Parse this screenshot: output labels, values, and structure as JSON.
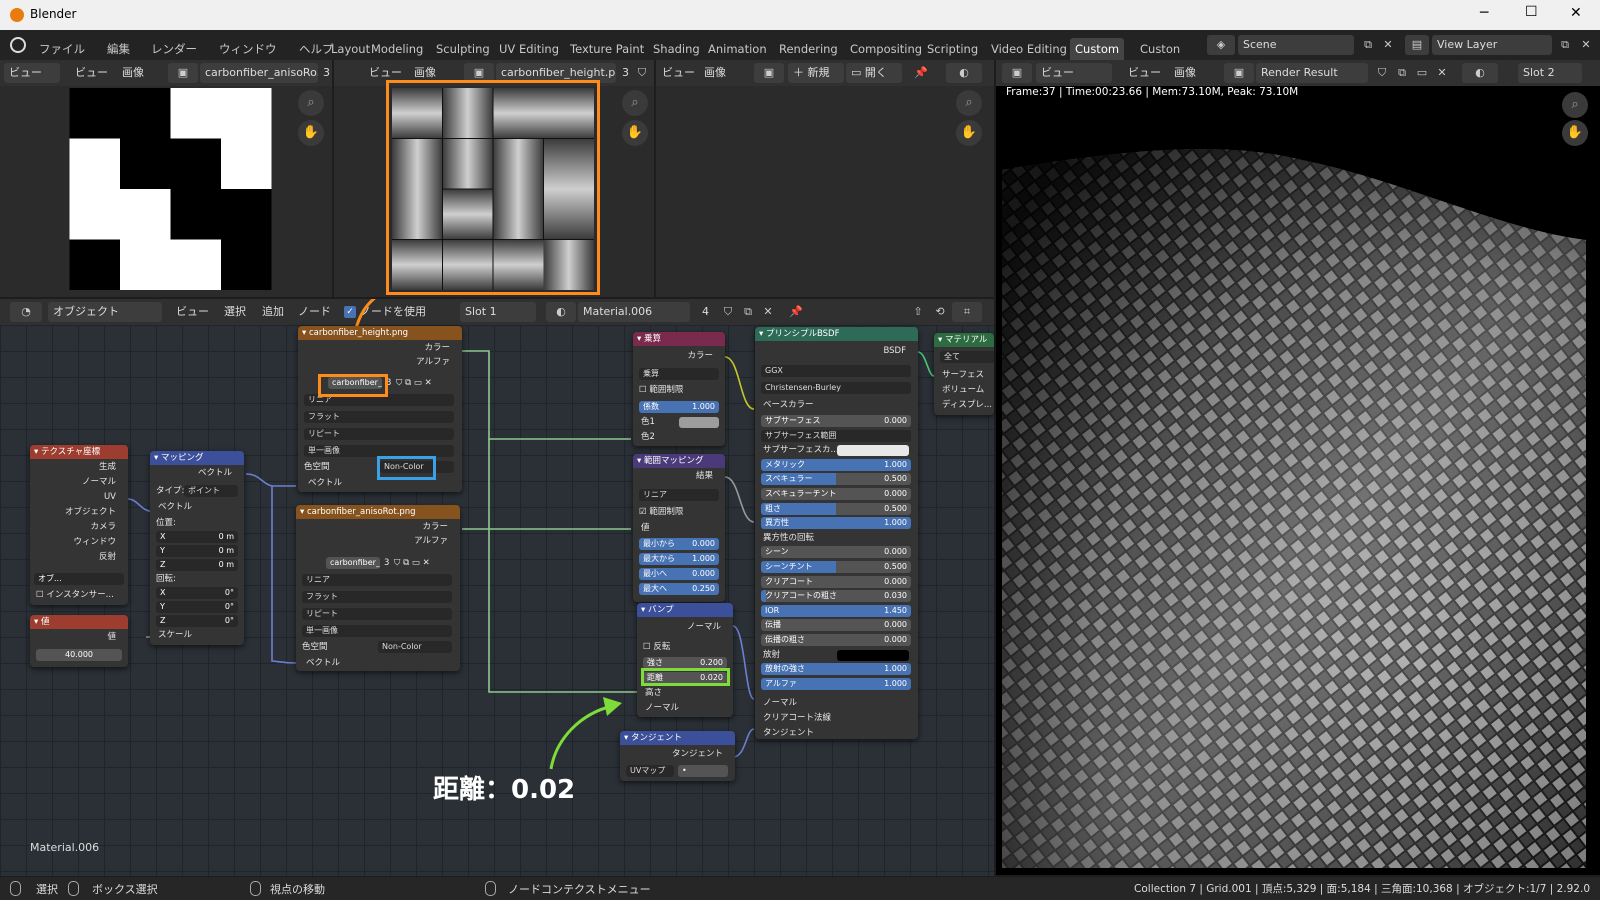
{
  "window": {
    "title": "Blender",
    "minimize": "─",
    "maximize": "☐",
    "close": "✕"
  },
  "menu": [
    "ファイル",
    "編集",
    "レンダー",
    "ウィンドウ",
    "ヘルプ"
  ],
  "workspaces": [
    "Layout",
    "Modeling",
    "Sculpting",
    "UV Editing",
    "Texture Paint",
    "Shading",
    "Animation",
    "Rendering",
    "Compositing",
    "Scripting",
    "Video Editing",
    "Custom",
    "Custon"
  ],
  "active_workspace": "Custom",
  "scene": "Scene",
  "view_layer": "View Layer",
  "image_editor_1": {
    "mode": "ビュー",
    "view": "ビュー",
    "image": "画像",
    "image_name": "carbonfiber_anisoRo...",
    "users": "3"
  },
  "image_editor_2": {
    "view": "ビュー",
    "image": "画像",
    "image_name": "carbonfiber_height.p...",
    "users": "3"
  },
  "image_editor_3": {
    "view": "ビュー",
    "image": "画像",
    "new": "新規",
    "open": "開く"
  },
  "render_editor": {
    "view": "ビュー",
    "view2": "ビュー",
    "image": "画像",
    "result": "Render Result",
    "slot": "Slot 2",
    "info": "Frame:37 | Time:00:23.66 | Mem:73.10M, Peak: 73.10M"
  },
  "node_editor": {
    "mode": "オブジェクト",
    "view": "ビュー",
    "select": "選択",
    "add": "追加",
    "node": "ノード",
    "use_nodes": "ノードを使用",
    "slot": "Slot 1",
    "material": "Material.006",
    "users": "4",
    "footer_material": "Material.006"
  },
  "nodes": {
    "texcoord": {
      "title": "テクスチャ座標",
      "outputs": [
        "生成",
        "ノーマル",
        "UV",
        "オブジェクト",
        "カメラ",
        "ウィンドウ",
        "反射"
      ],
      "object_label": "オブ...",
      "instancer": "インスタンサー..."
    },
    "value": {
      "title": "値",
      "output": "値",
      "value": "40.000"
    },
    "mapping": {
      "title": "マッピング",
      "output": "ベクトル",
      "type_label": "タイプ:",
      "type": "ポイント",
      "vector": "ベクトル",
      "location": "位置:",
      "loc": [
        [
          "X",
          "0 m"
        ],
        [
          "Y",
          "0 m"
        ],
        [
          "Z",
          "0 m"
        ]
      ],
      "rotation": "回転:",
      "rot": [
        [
          "X",
          "0°"
        ],
        [
          "Y",
          "0°"
        ],
        [
          "Z",
          "0°"
        ]
      ],
      "scale": "スケール"
    },
    "height": {
      "title": "carbonfiber_height.png",
      "out_color": "カラー",
      "out_alpha": "アルファ",
      "image": "carbonfiber_...",
      "users": "3",
      "interp": "リニア",
      "proj": "フラット",
      "ext": "リピート",
      "source": "単一画像",
      "cs_label": "色空間",
      "colorspace": "Non-Color",
      "vector": "ベクトル"
    },
    "aniso": {
      "title": "carbonfiber_anisoRot.png",
      "out_color": "カラー",
      "out_alpha": "アルファ",
      "image": "carbonfiber_...",
      "users": "3",
      "interp": "リニア",
      "proj": "フラット",
      "ext": "リピート",
      "source": "単一画像",
      "cs_label": "色空間",
      "colorspace": "Non-Color",
      "vector": "ベクトル"
    },
    "multiply": {
      "title": "乗算",
      "out": "カラー",
      "blend": "乗算",
      "clamp": "範囲制限",
      "fac_label": "係数",
      "fac": "1.000",
      "c1": "色1",
      "c2": "色2"
    },
    "maprange": {
      "title": "範囲マッピング",
      "out": "結果",
      "interp": "リニア",
      "clamp": "範囲制限",
      "value": "値",
      "rows": [
        [
          "最小から",
          "0.000"
        ],
        [
          "最大から",
          "1.000"
        ],
        [
          "最小へ",
          "0.000"
        ],
        [
          "最大へ",
          "0.250"
        ]
      ]
    },
    "bump": {
      "title": "バンプ",
      "out": "ノーマル",
      "invert": "反転",
      "strength_label": "強さ",
      "strength": "0.200",
      "distance_label": "距離",
      "distance": "0.020",
      "height": "高さ",
      "normal": "ノーマル"
    },
    "tangent": {
      "title": "タンジェント",
      "out": "タンジェント",
      "mode": "UVマップ",
      "map": "•"
    },
    "bsdf": {
      "title": "プリンシプルBSDF",
      "out": "BSDF",
      "dist": "GGX",
      "sss_method": "Christensen-Burley",
      "base_color": "ベースカラー",
      "rows": [
        [
          "サブサーフェス",
          "0.000",
          0
        ],
        [
          "サブサーフェス範囲",
          "",
          -1
        ],
        [
          "サブサーフェスカ...",
          "",
          -2
        ],
        [
          "メタリック",
          "1.000",
          1
        ],
        [
          "スペキュラー",
          "0.500",
          0.5
        ],
        [
          "スペキュラーチント",
          "0.000",
          0
        ],
        [
          "粗さ",
          "0.500",
          0.5
        ],
        [
          "異方性",
          "1.000",
          1
        ],
        [
          "異方性の回転",
          "",
          -3
        ],
        [
          "シーン",
          "0.000",
          0
        ],
        [
          "シーンチント",
          "0.500",
          0.5
        ],
        [
          "クリアコート",
          "0.000",
          0
        ],
        [
          "クリアコートの粗さ",
          "0.030",
          0.03
        ],
        [
          "IOR",
          "1.450",
          1
        ],
        [
          "伝播",
          "0.000",
          0
        ],
        [
          "伝播の粗さ",
          "0.000",
          0
        ],
        [
          "放射",
          "",
          -4
        ],
        [
          "放射の強さ",
          "1.000",
          1
        ],
        [
          "アルファ",
          "1.000",
          1
        ]
      ],
      "inputs_bottom": [
        "ノーマル",
        "クリアコート法線",
        "タンジェント"
      ]
    },
    "output": {
      "title": "マテリアル",
      "target": "全て",
      "inputs": [
        "サーフェス",
        "ボリューム",
        "ディスプレ..."
      ]
    }
  },
  "annotation": {
    "text": "距離：0.02",
    "color": "#7ddc3a",
    "highlight_orange": "#ff8c1a",
    "highlight_blue": "#3aa0e8",
    "highlight_green": "#7ddc3a"
  },
  "status": {
    "select": "選択",
    "box": "ボックス選択",
    "move": "視点の移動",
    "context": "ノードコンテクストメニュー",
    "info": "Collection 7 | Grid.001 | 頂点:5,329 | 面:5,184 | 三角面:10,368 | オブジェクト:1/7 | 2.92.0"
  }
}
